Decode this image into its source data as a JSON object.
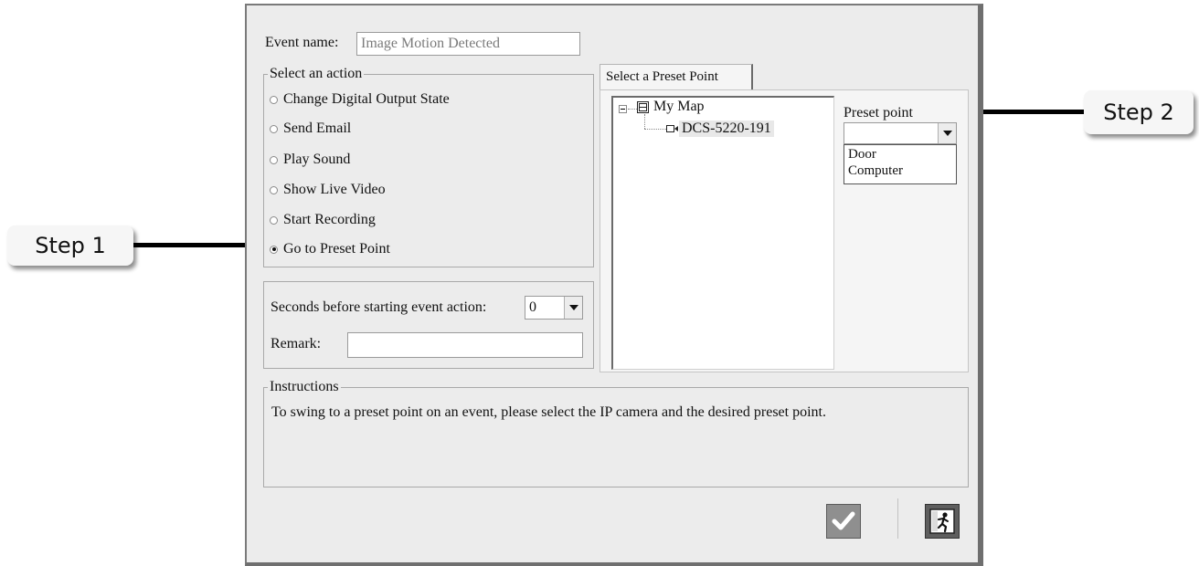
{
  "event": {
    "name_label": "Event name:",
    "name_value": "Image Motion Detected"
  },
  "action_group": {
    "title": "Select an action",
    "options": [
      {
        "label": "Change Digital Output State",
        "selected": false
      },
      {
        "label": "Send Email",
        "selected": false
      },
      {
        "label": "Play Sound",
        "selected": false
      },
      {
        "label": "Show Live Video",
        "selected": false
      },
      {
        "label": "Start Recording",
        "selected": false
      },
      {
        "label": "Go to Preset Point",
        "selected": true
      }
    ]
  },
  "delay": {
    "label": "Seconds before starting event action:",
    "value": "0"
  },
  "remark": {
    "label": "Remark:",
    "value": ""
  },
  "preset_tab": {
    "label": "Select a Preset Point"
  },
  "tree": {
    "root": "My Map",
    "camera": "DCS-5220-191"
  },
  "preset_point": {
    "label": "Preset point",
    "selected": "",
    "options": [
      "Door",
      "Computer"
    ]
  },
  "instructions": {
    "title": "Instructions",
    "text": "To swing to a preset point on an event, please select the IP camera and the desired preset point."
  },
  "callouts": {
    "step1": "Step 1",
    "step2": "Step 2"
  },
  "colors": {
    "dialog_bg": "#ececec",
    "ok_button": "#8f8f8f",
    "exit_button": "#5e5e5e"
  },
  "icons": {
    "ok": "checkmark-icon",
    "exit": "exit-running-man-icon",
    "map": "map-icon",
    "camera": "camera-icon"
  }
}
